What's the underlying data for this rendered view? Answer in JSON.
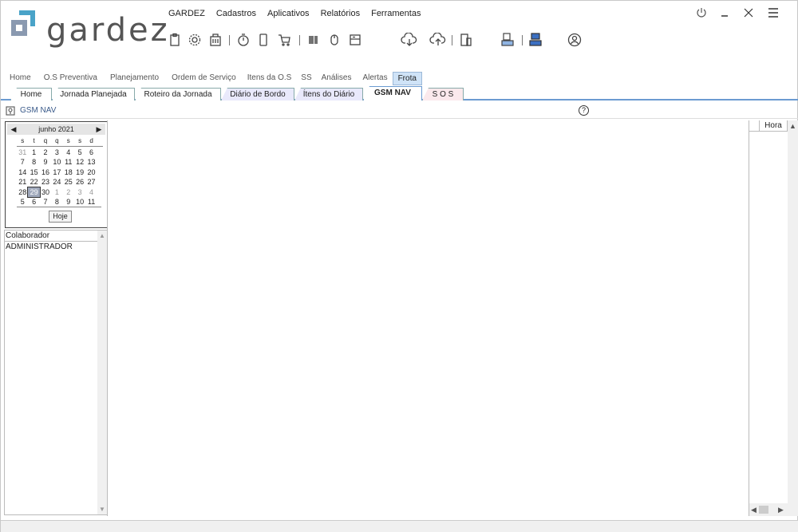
{
  "app": {
    "brand": "gardez",
    "accent": "#6b9bd1",
    "logo_colors": [
      "#4aa3c8",
      "#8a99b0"
    ]
  },
  "top_menu": [
    "GARDEZ",
    "Cadastros",
    "Aplicativos",
    "Relatórios",
    "Ferramentas"
  ],
  "toolbar_icons": [
    "clipboard-icon",
    "gear-icon",
    "building-icon",
    "stopwatch-icon",
    "phone-icon",
    "cart-icon",
    "barcode-icon",
    "mouse-icon",
    "server-icon",
    "cloud-download-icon",
    "cloud-upload-icon",
    "devices-icon",
    "document-transfer-icon",
    "network-icon",
    "user-circle-icon"
  ],
  "window_controls": [
    "power-icon",
    "minimize-icon",
    "close-icon",
    "menu-icon"
  ],
  "module_tabs": [
    "Home",
    "O.S Preventiva",
    "Planejamento",
    "Ordem de Serviço",
    "Itens da O.S",
    "SS",
    "Análises",
    "Alertas",
    "Frota"
  ],
  "active_module": "Frota",
  "sub_tabs": [
    "Home",
    "Jornada Planejada",
    "Roteiro da Jornada",
    "Diário de Bordo",
    "Ítens do Diário",
    "GSM NAV",
    "S O S"
  ],
  "active_sub_tab": "GSM NAV",
  "panel": {
    "title": "GSM NAV",
    "help": "?"
  },
  "calendar": {
    "month_label": "junho 2021",
    "weekdays": [
      "s",
      "t",
      "q",
      "q",
      "s",
      "s",
      "d"
    ],
    "weeks": [
      [
        "31",
        "1",
        "2",
        "3",
        "4",
        "5",
        "6"
      ],
      [
        "7",
        "8",
        "9",
        "10",
        "11",
        "12",
        "13"
      ],
      [
        "14",
        "15",
        "16",
        "17",
        "18",
        "19",
        "20"
      ],
      [
        "21",
        "22",
        "23",
        "24",
        "25",
        "26",
        "27"
      ],
      [
        "28",
        "29",
        "30",
        "1",
        "2",
        "3",
        "4"
      ],
      [
        "5",
        "6",
        "7",
        "8",
        "9",
        "10",
        "11"
      ]
    ],
    "selected": "29",
    "today_button": "Hoje"
  },
  "collaborators": {
    "header": "Colaborador",
    "rows": [
      "ADMINISTRADOR"
    ]
  },
  "right_grid": {
    "header": "Hora"
  }
}
